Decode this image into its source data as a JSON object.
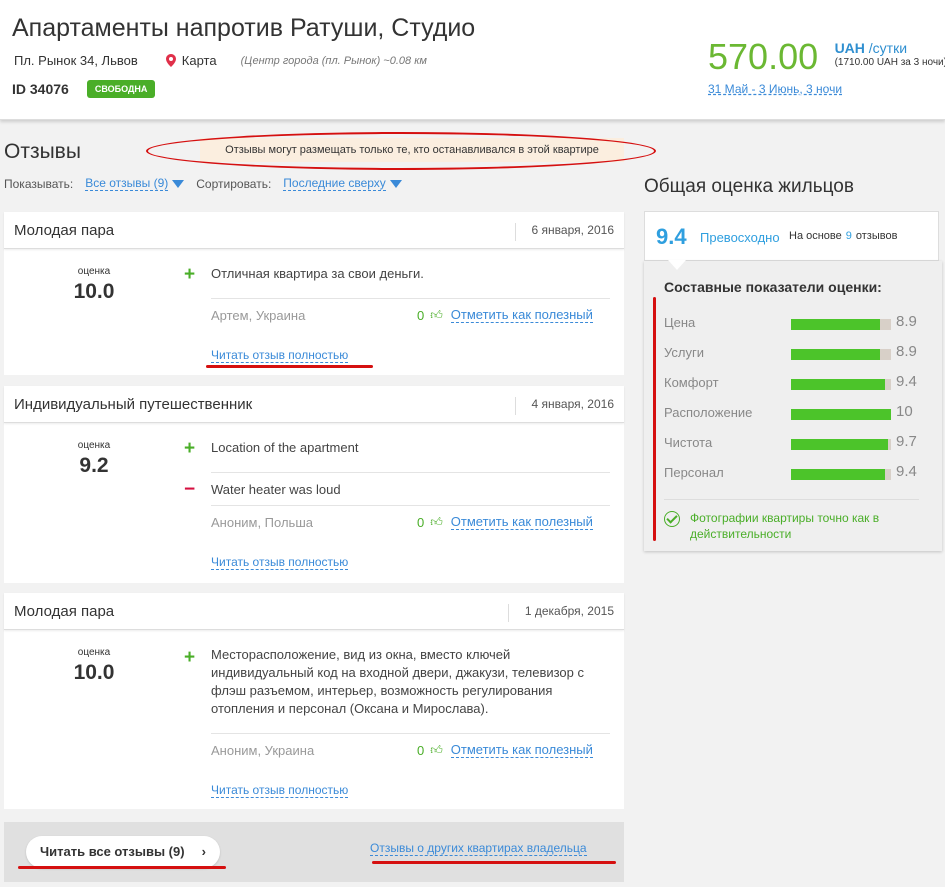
{
  "header": {
    "title": "Апартаменты напротив Ратуши, Студио",
    "address": "Пл. Рынок 34, Львов",
    "map_label": "Карта",
    "distance": "(Центр города (пл. Рынок) ~0.08 км",
    "id": "ID 34076",
    "status_badge": "СВОБОДНА",
    "price": "570.00",
    "currency": "UAH",
    "per": "/сутки",
    "total": "(1710.00 UAH за 3 ночи)",
    "dates": "31 Май - 3 Июнь, 3 ночи"
  },
  "reviews": {
    "title": "Отзывы",
    "notice": "Отзывы могут размещать только те, кто останавливался в этой квартире",
    "show_label": "Показывать:",
    "show_value": "Все отзывы (9)",
    "sort_label": "Сортировать:",
    "sort_value": "Последние сверху",
    "score_label": "оценка",
    "mark_useful": "Отметить как полезный",
    "read_full": "Читать отзыв полностью",
    "items": [
      {
        "name": "Молодая пара",
        "date": "6 января, 2016",
        "score": "10.0",
        "plus": "Отличная квартира за свои деньги.",
        "minus": "",
        "author": "Артем, Украина",
        "useful_count": "0"
      },
      {
        "name": "Индивидуальный путешественник",
        "date": "4 января, 2016",
        "score": "9.2",
        "plus": "Location of the apartment",
        "minus": "Water heater was loud",
        "author": "Аноним, Польша",
        "useful_count": "0"
      },
      {
        "name": "Молодая пара",
        "date": "1 декабря, 2015",
        "score": "10.0",
        "plus": "Месторасположение, вид из окна, вместо ключей индивидуальный код на входной двери, джакузи, телевизор с флэш разъемом, интерьер, возможность регулирования отопления и персонал (Оксана и Мирослава).",
        "minus": "",
        "author": "Аноним, Украина",
        "useful_count": "0"
      }
    ],
    "read_all": "Читать все отзывы (9)",
    "other_link": "Отзывы о других квартирах владельца"
  },
  "overall": {
    "title": "Общая оценка жильцов",
    "score": "9.4",
    "verdict": "Превосходно",
    "based_on": "На основе",
    "count": "9",
    "reviews_word": "отзывов",
    "components_title": "Составные показатели оценки:",
    "components": [
      {
        "label": "Цена",
        "value": "8.9",
        "fraction": 0.89
      },
      {
        "label": "Услуги",
        "value": "8.9",
        "fraction": 0.89
      },
      {
        "label": "Комфорт",
        "value": "9.4",
        "fraction": 0.94
      },
      {
        "label": "Расположение",
        "value": "10",
        "fraction": 1.0
      },
      {
        "label": "Чистота",
        "value": "9.7",
        "fraction": 0.97
      },
      {
        "label": "Персонал",
        "value": "9.4",
        "fraction": 0.94
      }
    ],
    "photos_note": "Фотографии квартиры точно как в действительности"
  },
  "colors": {
    "accent_blue": "#3a8ad8",
    "price_green": "#6bb833",
    "bar_green": "#4cc42a",
    "annotation_red": "#d51010"
  }
}
